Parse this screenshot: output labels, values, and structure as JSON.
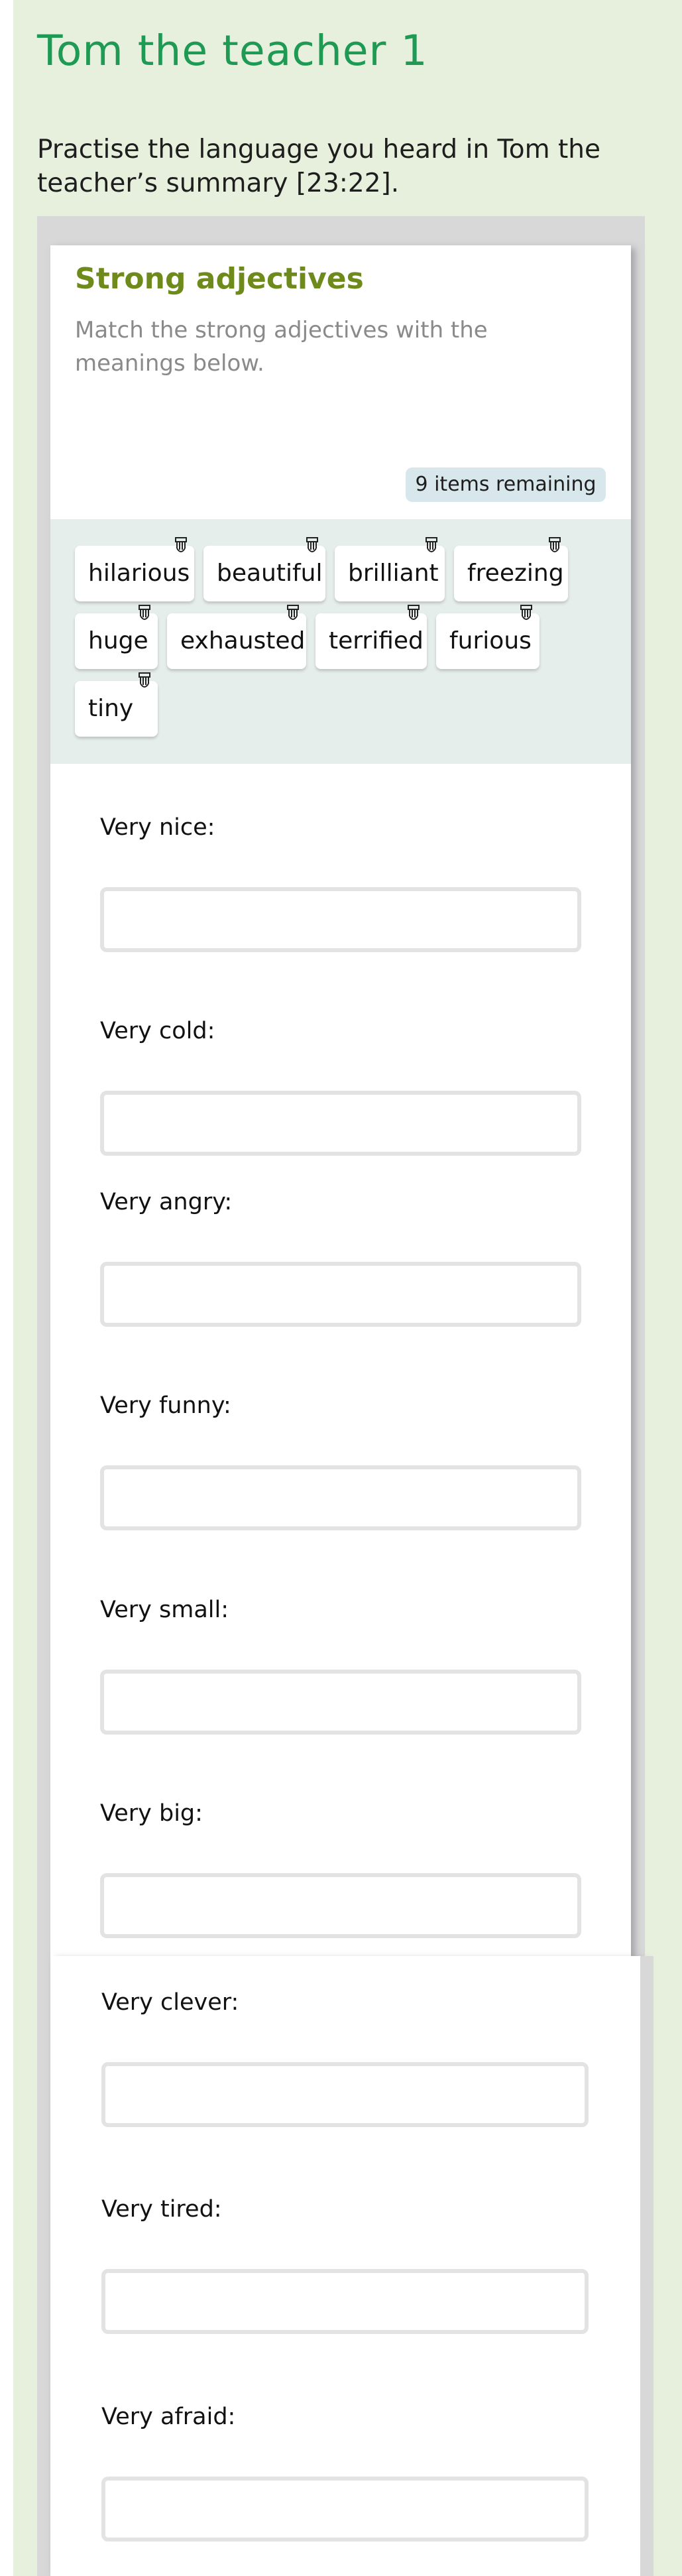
{
  "page": {
    "title": "Tom the teacher 1",
    "intro": "Practise the language you heard in Tom the teacher’s summary [23:22]."
  },
  "activity": {
    "title": "Strong adjectives",
    "description": "Match the strong adjectives with the meanings below.",
    "remaining": "9 items remaining"
  },
  "word_bank": [
    {
      "label": "hilarious",
      "icon": "drag-hand-icon"
    },
    {
      "label": "beautiful",
      "icon": "drag-hand-icon"
    },
    {
      "label": "brilliant",
      "icon": "drag-hand-icon"
    },
    {
      "label": "freezing",
      "icon": "drag-hand-icon"
    },
    {
      "label": "huge",
      "icon": "drag-hand-icon"
    },
    {
      "label": "exhausted",
      "icon": "drag-hand-icon"
    },
    {
      "label": "terrified",
      "icon": "drag-hand-icon"
    },
    {
      "label": "furious",
      "icon": "drag-hand-icon"
    },
    {
      "label": "tiny",
      "icon": "drag-hand-icon"
    }
  ],
  "questions": [
    {
      "label": "Very nice:",
      "answer": ""
    },
    {
      "label": "Very cold:",
      "answer": ""
    },
    {
      "label": "Very angry:",
      "answer": ""
    },
    {
      "label": "Very funny:",
      "answer": ""
    },
    {
      "label": "Very small:",
      "answer": ""
    },
    {
      "label": "Very big:",
      "answer": ""
    },
    {
      "label": "Very clever:",
      "answer": ""
    },
    {
      "label": "Very tired:",
      "answer": ""
    },
    {
      "label": "Very afraid:",
      "answer": ""
    }
  ],
  "colors": {
    "page_background": "#e7f0dc",
    "title": "#1f9a55",
    "activity_title": "#6e8a1a",
    "badge": "#d7e7ec",
    "bank_background": "#e6eeec"
  }
}
